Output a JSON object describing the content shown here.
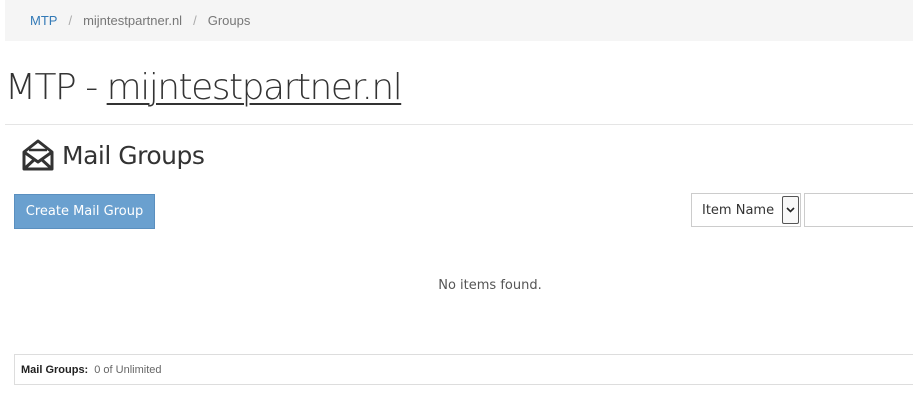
{
  "breadcrumb": {
    "items": [
      {
        "label": "MTP"
      },
      {
        "label": "mijntestpartner.nl"
      },
      {
        "label": "Groups"
      }
    ],
    "separator": "/"
  },
  "page": {
    "title_prefix": "MTP - ",
    "title_domain": "mijntestpartner.nl"
  },
  "section": {
    "icon": "envelope-open-icon",
    "title": "Mail Groups"
  },
  "toolbar": {
    "create_label": "Create Mail Group",
    "filter_selected": "Item Name",
    "search_value": ""
  },
  "list": {
    "empty_message": "No items found."
  },
  "quota": {
    "label": "Mail Groups:",
    "value": "0 of Unlimited"
  },
  "colors": {
    "accent": "#337ab7",
    "button": "#6aa0cf"
  }
}
